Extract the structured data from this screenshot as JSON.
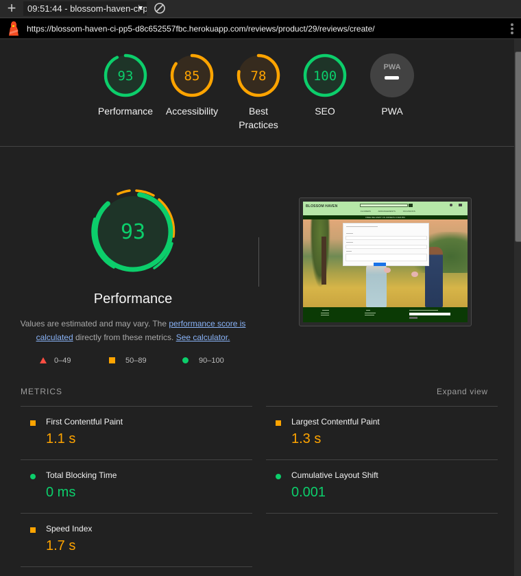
{
  "toolbar": {
    "new_report_label": "+",
    "report_selector": "09:51:44 - blossom-haven-ci-p",
    "clear_icon": "block-icon"
  },
  "urlbar": {
    "icon": "lighthouse-icon",
    "url": "https://blossom-haven-ci-pp5-d8c652557fbc.herokuapp.com/reviews/product/29/reviews/create/",
    "menu_icon": "kebab-menu-icon"
  },
  "summary": {
    "gauges": [
      {
        "label": "Performance",
        "score": 93,
        "status": "pass",
        "color": "#0cce6b"
      },
      {
        "label": "Accessibility",
        "score": 85,
        "status": "average",
        "color": "#ffa400"
      },
      {
        "label": "Best Practices",
        "label_line1": "Best",
        "label_line2": "Practices",
        "score": 78,
        "status": "average",
        "color": "#ffa400"
      },
      {
        "label": "SEO",
        "score": 100,
        "status": "pass",
        "color": "#0cce6b"
      },
      {
        "label": "PWA",
        "badge": "PWA",
        "score": null,
        "status": "not-applicable",
        "color": "#9e9e9e"
      }
    ]
  },
  "performance": {
    "score": 93,
    "title": "Performance",
    "description_prefix": "Values are estimated and may vary. The ",
    "link_score": "performance score is calculated",
    "description_mid": " directly from these metrics. ",
    "link_calculator": "See calculator.",
    "legend": [
      {
        "shape": "triangle",
        "range": "0–49",
        "color": "#ff4e42"
      },
      {
        "shape": "square",
        "range": "50–89",
        "color": "#ffa400"
      },
      {
        "shape": "circle",
        "range": "90–100",
        "color": "#0cce6b"
      }
    ],
    "screenshot": {
      "site_logo": "BLOSSOM HAVEN",
      "banner_text": "FREE DELIVERY ON ORDERS OVER €50",
      "nav_items": [
        "FLOWERS",
        "ARRANGEMENTS",
        "OCCASIONS"
      ]
    }
  },
  "metrics": {
    "header": "METRICS",
    "expand_label": "Expand view",
    "items": [
      {
        "name": "First Contentful Paint",
        "value": "1.1 s",
        "rating": "average",
        "indicator": "square"
      },
      {
        "name": "Largest Contentful Paint",
        "value": "1.3 s",
        "rating": "average",
        "indicator": "square"
      },
      {
        "name": "Total Blocking Time",
        "value": "0 ms",
        "rating": "pass",
        "indicator": "circle"
      },
      {
        "name": "Cumulative Layout Shift",
        "value": "0.001",
        "rating": "pass",
        "indicator": "circle"
      },
      {
        "name": "Speed Index",
        "value": "1.7 s",
        "rating": "average",
        "indicator": "square"
      }
    ]
  },
  "colors": {
    "pass": "#0cce6b",
    "average": "#ffa400",
    "fail": "#ff4e42",
    "link": "#8ab4f8",
    "background": "#212121"
  }
}
